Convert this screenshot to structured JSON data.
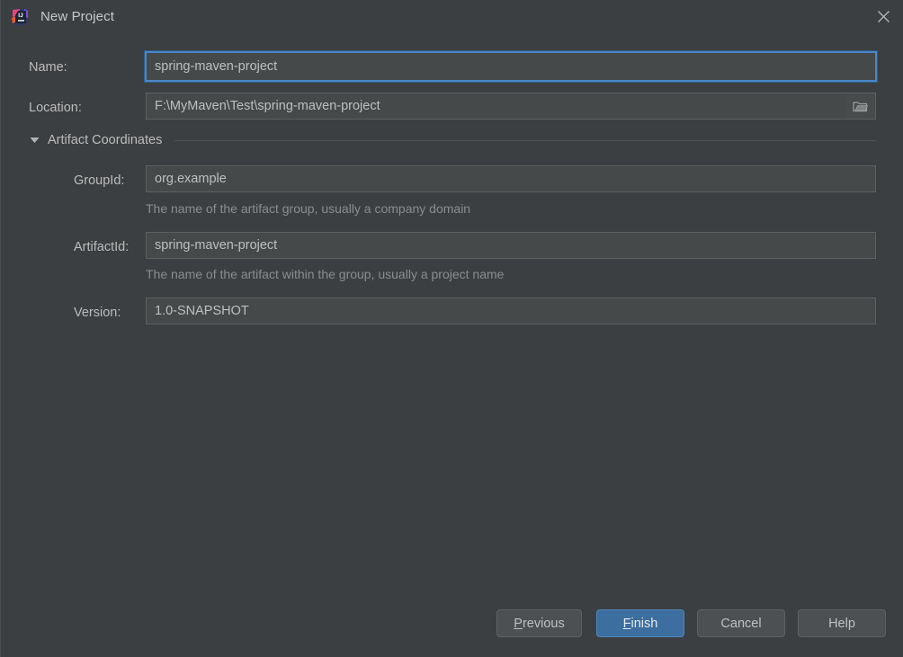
{
  "window": {
    "title": "New Project",
    "app_icon": "intellij-idea-icon",
    "close_icon": "close-icon",
    "background_color": "#3c3f41"
  },
  "form": {
    "name": {
      "label": "Name:",
      "value": "spring-maven-project",
      "placeholder": "Name",
      "focused": true
    },
    "location": {
      "label": "Location:",
      "value": "F:\\MyMaven\\Test\\spring-maven-project",
      "placeholder": "Location",
      "browse_icon": "folder-icon"
    },
    "artifact_section": {
      "title": "Artifact Coordinates",
      "expanded": true,
      "disclosure_icon": "triangle-down-icon"
    },
    "group_id": {
      "label": "GroupId:",
      "value": "org.example",
      "placeholder": "GroupId",
      "hint": "The name of the artifact group, usually a company domain"
    },
    "artifact_id": {
      "label": "ArtifactId:",
      "value": "spring-maven-project",
      "placeholder": "ArtifactId",
      "hint": "The name of the artifact within the group, usually a project name"
    },
    "version": {
      "label": "Version:",
      "value": "1.0-SNAPSHOT",
      "placeholder": "Version"
    }
  },
  "buttons": {
    "previous": {
      "label_before": "",
      "mnemonic": "P",
      "label_after": "revious"
    },
    "finish": {
      "label_before": "",
      "mnemonic": "F",
      "label_after": "inish",
      "primary": true
    },
    "cancel": {
      "label": "Cancel"
    },
    "help": {
      "label": "Help"
    }
  },
  "colors": {
    "accent": "#3c6e9f",
    "focus_border": "#4a88c7",
    "field_bg": "#45494a",
    "field_border": "#5e6060",
    "text": "#bbbbbb",
    "hint_text": "#8a8d8f"
  }
}
